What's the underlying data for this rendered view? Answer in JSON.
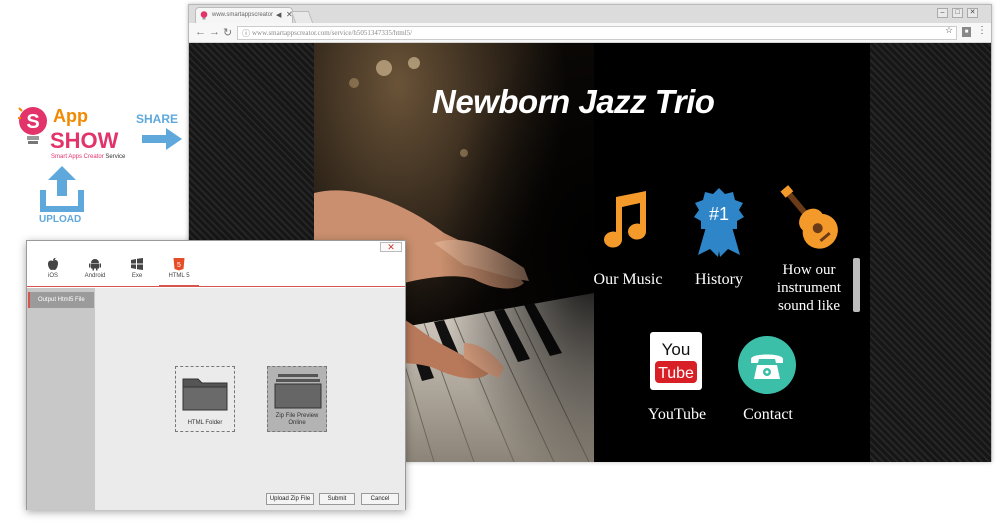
{
  "logo": {
    "app_text": "App",
    "show_text": "SHOW",
    "tagline_red": "Smart Apps Creator",
    "tagline_rest": " Service"
  },
  "actions": {
    "share_label": "SHARE",
    "upload_label": "UPLOAD"
  },
  "browser": {
    "tab_title": "www.smartappscreator",
    "address": "www.smartappscreator.com/service/h5051347335/html5/",
    "favicon_icon": "app-show-favicon",
    "window_controls": [
      "–",
      "□",
      "✕"
    ]
  },
  "site": {
    "title": "Newborn Jazz Trio",
    "menu": [
      {
        "label": "Our Music",
        "icon": "music-note-icon"
      },
      {
        "label": "History",
        "icon": "number-one-badge-icon",
        "badge": "#1"
      },
      {
        "label": "How our instrument sound like",
        "icon": "guitar-icon"
      },
      {
        "label": "YouTube",
        "icon": "youtube-logo-icon",
        "logo_text_top": "You",
        "logo_text_bottom": "Tube"
      },
      {
        "label": "Contact",
        "icon": "telephone-icon"
      }
    ]
  },
  "dialog": {
    "close_label": "✕",
    "platforms": [
      {
        "label": "iOS",
        "icon": "apple-icon"
      },
      {
        "label": "Android",
        "icon": "android-icon"
      },
      {
        "label": "Exe",
        "icon": "windows-icon"
      },
      {
        "label": "HTML 5",
        "icon": "html5-icon",
        "active": true
      }
    ],
    "sidebar_item": "Output Html5 File",
    "options": [
      {
        "label": "HTML Folder",
        "icon": "folder-icon"
      },
      {
        "label": "Zip File Preview Online",
        "icon": "zip-stack-icon",
        "selected": true
      }
    ],
    "buttons": {
      "upload_zip": "Upload Zip File",
      "submit": "Submit",
      "cancel": "Cancel"
    }
  },
  "colors": {
    "accent_blue": "#5fa8dc",
    "brand_pink": "#e2336b",
    "brand_orange": "#f08a00",
    "dialog_red": "#d9534f",
    "music_orange": "#f39a2b",
    "badge_blue": "#2e86c8",
    "contact_teal": "#3cbfa8"
  }
}
